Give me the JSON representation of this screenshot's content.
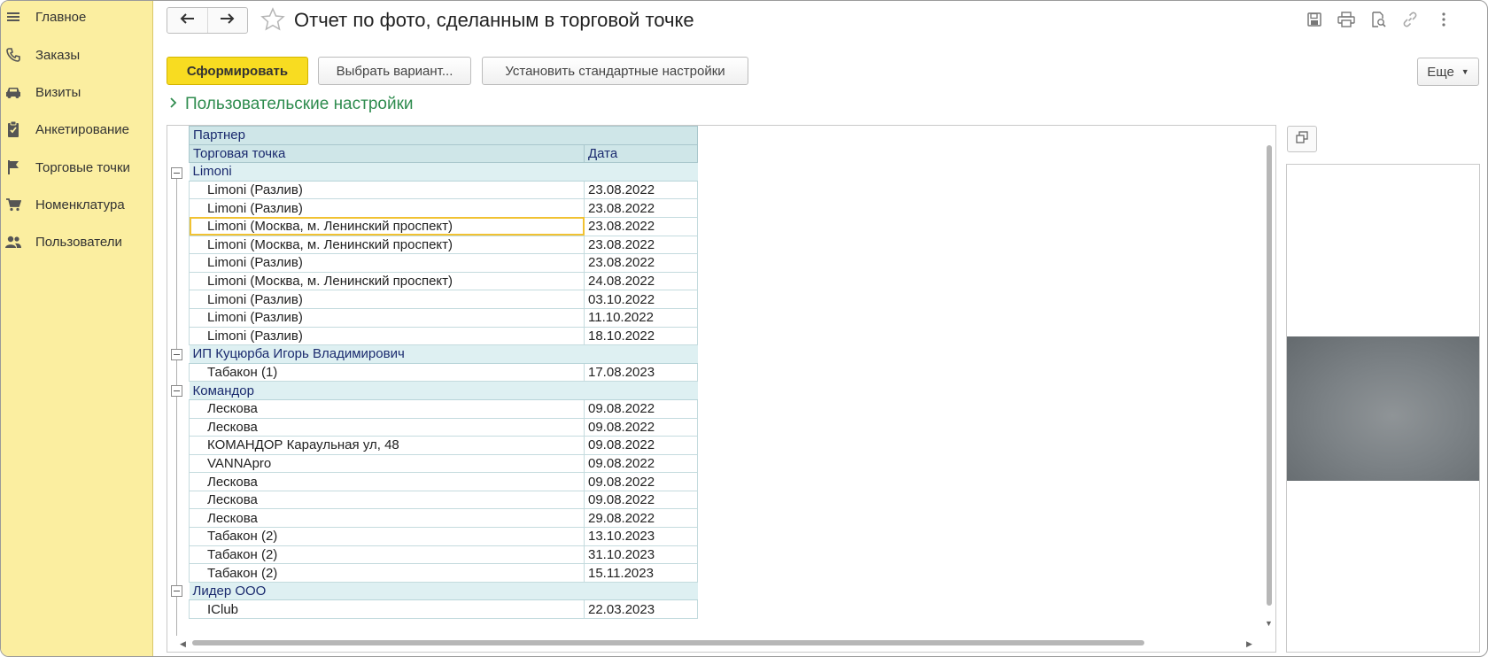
{
  "sidebar": {
    "items": [
      {
        "label": "Главное",
        "icon": "menu-icon"
      },
      {
        "label": "Заказы",
        "icon": "phone-icon"
      },
      {
        "label": "Визиты",
        "icon": "car-icon"
      },
      {
        "label": "Анкетирование",
        "icon": "clipboard-icon"
      },
      {
        "label": "Торговые точки",
        "icon": "flag-icon"
      },
      {
        "label": "Номенклатура",
        "icon": "cart-icon"
      },
      {
        "label": "Пользователи",
        "icon": "users-icon"
      }
    ]
  },
  "header": {
    "title": "Отчет по фото, сделанным в торговой точке",
    "back_icon": "arrow-left-icon",
    "forward_icon": "arrow-right-icon",
    "favorite_icon": "star-icon",
    "tool_icons": [
      "save-icon",
      "print-icon",
      "preview-icon",
      "link-icon",
      "more-vertical-icon"
    ]
  },
  "toolbar": {
    "generate_label": "Сформировать",
    "choose_variant_label": "Выбрать вариант...",
    "set_default_label": "Установить стандартные настройки",
    "more_label": "Еще"
  },
  "settings": {
    "label": "Пользовательские настройки"
  },
  "report": {
    "header_partner": "Партнер",
    "header_point": "Торговая точка",
    "header_date": "Дата",
    "groups": [
      {
        "partner": "Limoni",
        "rows": [
          {
            "point": "Limoni (Разлив)",
            "date": "23.08.2022"
          },
          {
            "point": "Limoni (Разлив)",
            "date": "23.08.2022"
          },
          {
            "point": "Limoni (Москва, м. Ленинский проспект)",
            "date": "23.08.2022",
            "selected": true
          },
          {
            "point": "Limoni (Москва, м. Ленинский проспект)",
            "date": "23.08.2022"
          },
          {
            "point": "Limoni (Разлив)",
            "date": "23.08.2022"
          },
          {
            "point": "Limoni (Москва, м. Ленинский проспект)",
            "date": "24.08.2022"
          },
          {
            "point": "Limoni (Разлив)",
            "date": "03.10.2022"
          },
          {
            "point": "Limoni (Разлив)",
            "date": "11.10.2022"
          },
          {
            "point": "Limoni (Разлив)",
            "date": "18.10.2022"
          }
        ]
      },
      {
        "partner": "ИП Куцюрба Игорь Владимирович",
        "rows": [
          {
            "point": "Табакон (1)",
            "date": "17.08.2023"
          }
        ]
      },
      {
        "partner": "Командор",
        "rows": [
          {
            "point": "Лескова",
            "date": "09.08.2022"
          },
          {
            "point": "Лескова",
            "date": "09.08.2022"
          },
          {
            "point": "КОМАНДОР Караульная ул, 48",
            "date": "09.08.2022"
          },
          {
            "point": "VANNApro",
            "date": "09.08.2022"
          },
          {
            "point": "Лескова",
            "date": "09.08.2022"
          },
          {
            "point": "Лескова",
            "date": "09.08.2022"
          },
          {
            "point": "Лескова",
            "date": "29.08.2022"
          },
          {
            "point": "Табакон (2)",
            "date": "13.10.2023"
          },
          {
            "point": "Табакон (2)",
            "date": "31.10.2023"
          },
          {
            "point": "Табакон (2)",
            "date": "15.11.2023"
          }
        ]
      },
      {
        "partner": "Лидер ООО",
        "rows": [
          {
            "point": "IClub",
            "date": "22.03.2023"
          }
        ]
      }
    ]
  },
  "photo_panel": {
    "expand_icon": "open-window-icon"
  },
  "colors": {
    "sidebar_bg": "#fbeea0",
    "primary_button": "#f8dc21",
    "settings_link": "#2f8c4f",
    "header_row_bg": "#cfe6e8",
    "selection_outline": "#f1c232"
  }
}
